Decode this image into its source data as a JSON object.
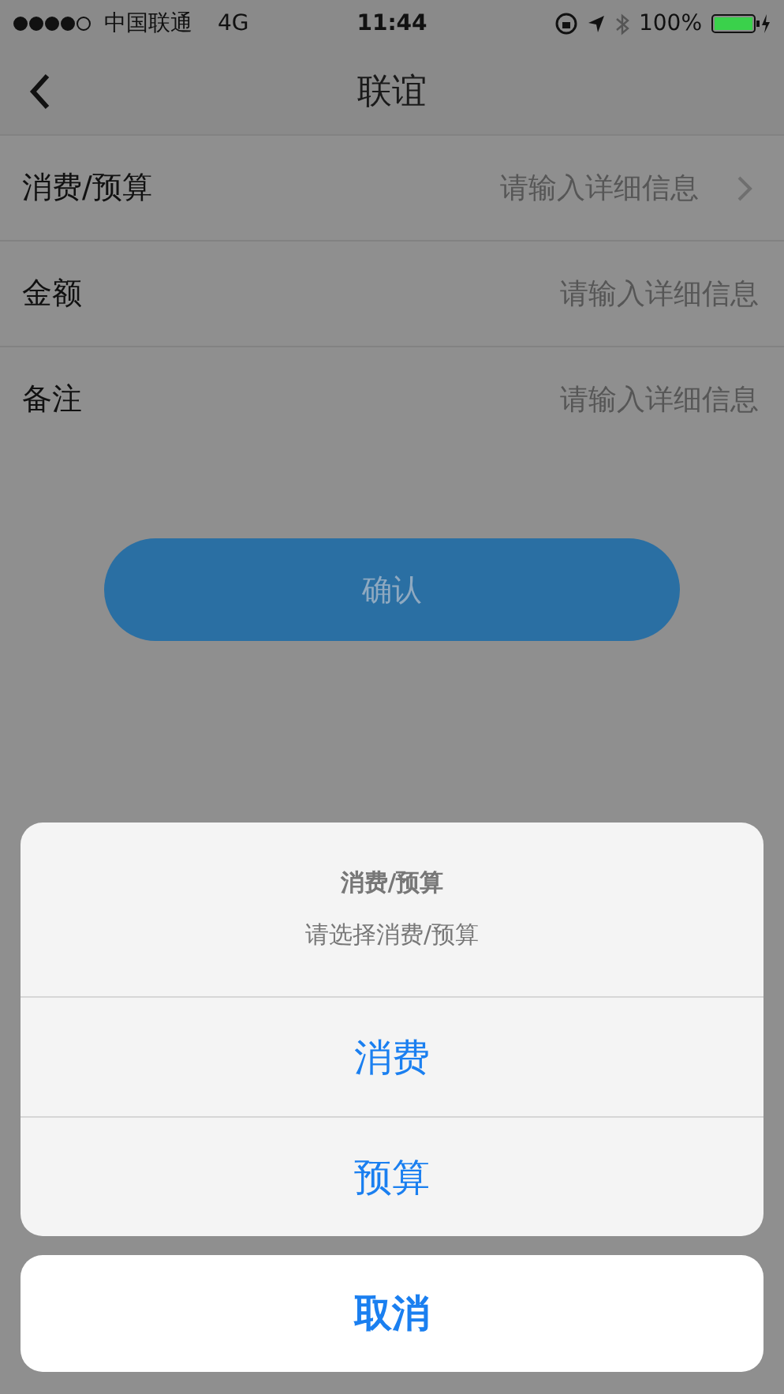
{
  "status_bar": {
    "carrier": "中国联通",
    "network": "4G",
    "time": "11:44",
    "battery": "100%"
  },
  "nav": {
    "title": "联谊"
  },
  "fields": [
    {
      "kind": "picker",
      "label": "消费/预算",
      "placeholder": "请输入详细信息"
    },
    {
      "kind": "input",
      "label": "金额",
      "placeholder": "请输入详细信息"
    },
    {
      "kind": "input",
      "label": "备注",
      "placeholder": "请输入详细信息"
    }
  ],
  "confirm_button": "确认",
  "action_sheet": {
    "title": "消费/预算",
    "message": "请选择消费/预算",
    "options": [
      "消费",
      "预算"
    ],
    "cancel": "取消"
  }
}
